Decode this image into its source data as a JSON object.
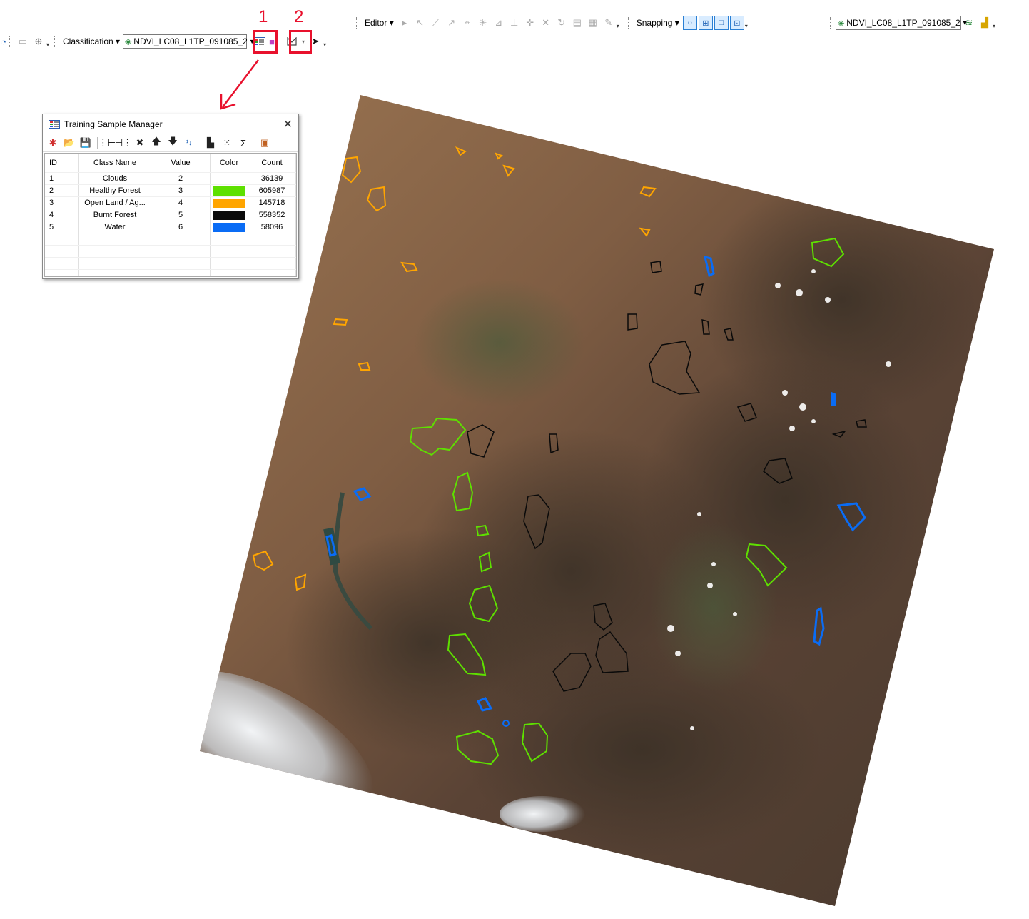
{
  "annotations": {
    "marker1": "1",
    "marker2": "2"
  },
  "toolbar_top": {
    "editor_label": "Editor",
    "snapping_label": "Snapping",
    "layer_combo": "NDVI_LC08_L1TP_091085_2"
  },
  "toolbar_class": {
    "classification_label": "Classification",
    "layer_combo": "NDVI_LC08_L1TP_091085_2"
  },
  "dialog": {
    "title": "Training Sample Manager",
    "columns": [
      "ID",
      "Class Name",
      "Value",
      "Color",
      "Count"
    ],
    "rows": [
      {
        "id": "1",
        "name": "Clouds",
        "value": "2",
        "color": "#ffffff",
        "count": "36139"
      },
      {
        "id": "2",
        "name": "Healthy Forest",
        "value": "3",
        "color": "#5ee000",
        "count": "605987"
      },
      {
        "id": "3",
        "name": "Open Land / Ag...",
        "value": "4",
        "color": "#ffa500",
        "count": "145718"
      },
      {
        "id": "4",
        "name": "Burnt Forest",
        "value": "5",
        "color": "#0a0a0a",
        "count": "558352"
      },
      {
        "id": "5",
        "name": "Water",
        "value": "6",
        "color": "#0a6cf5",
        "count": "58096"
      }
    ]
  },
  "colors": {
    "annotation_red": "#e8112d",
    "healthy_forest": "#5ee000",
    "open_land": "#ffa500",
    "burnt_forest": "#0a0a0a",
    "water": "#0a6cf5"
  }
}
